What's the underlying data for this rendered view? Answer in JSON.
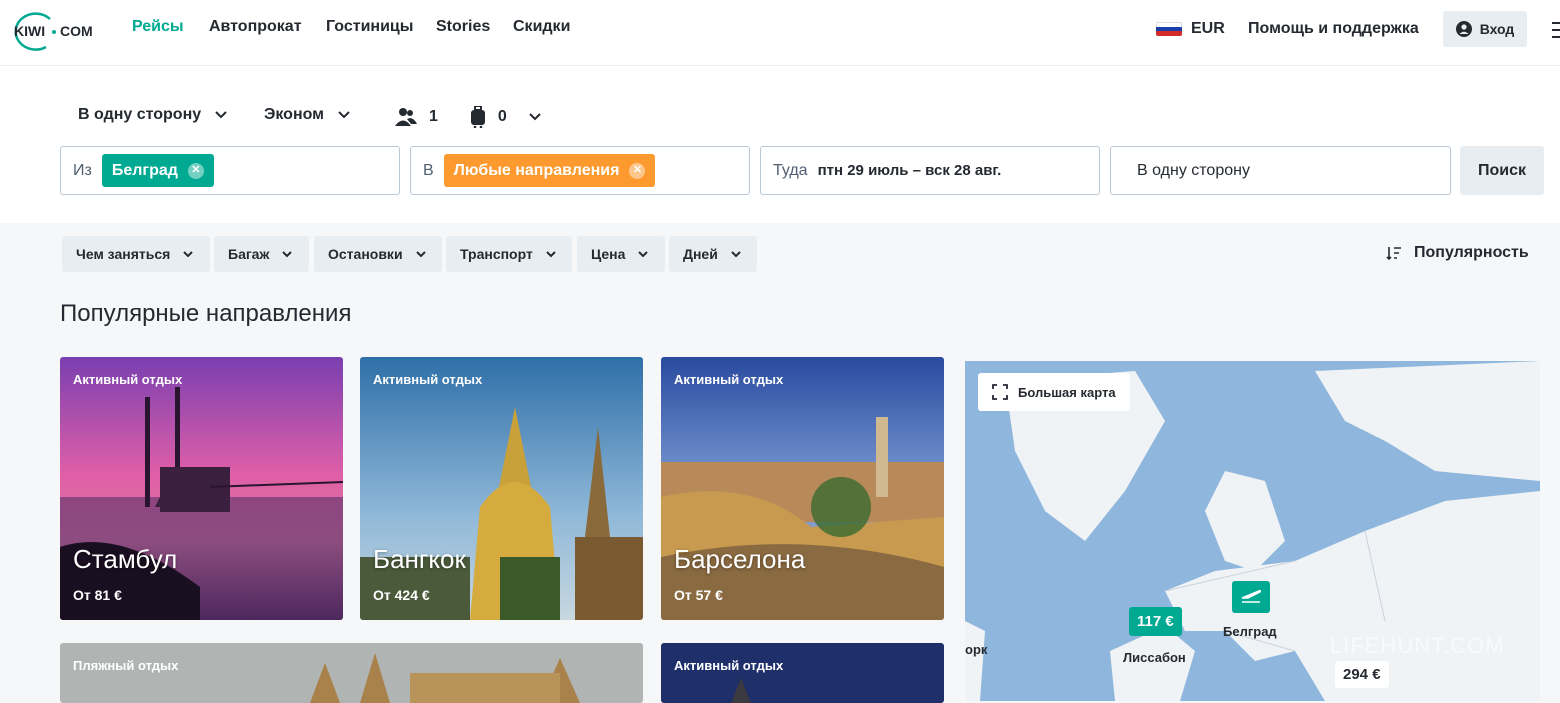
{
  "logo": {
    "text_left": "KIWI",
    "text_right": "COM"
  },
  "nav": [
    "Рейсы",
    "Автопрокат",
    "Гостиницы",
    "Stories",
    "Скидки"
  ],
  "header_right": {
    "currency": "EUR",
    "help": "Помощь и поддержка",
    "login": "Вход"
  },
  "search": {
    "trip_type": "В одну сторону",
    "cabin": "Эконом",
    "passengers": "1",
    "bags": "0",
    "from_label": "Из",
    "from_value": "Белград",
    "to_label": "В",
    "to_value": "Любые направления",
    "dates_label": "Туда",
    "dates_value": "птн 29 июль – вск 28 авг.",
    "return_value": "В одну сторону",
    "search_button": "Поиск"
  },
  "filters": [
    "Чем заняться",
    "Багаж",
    "Остановки",
    "Транспорт",
    "Цена",
    "Дней"
  ],
  "sort_label": "Популярность",
  "section_title": "Популярные направления",
  "cards": [
    {
      "category": "Активный отдых",
      "city": "Стамбул",
      "price": "От 81 €"
    },
    {
      "category": "Активный отдых",
      "city": "Бангкок",
      "price": "От 424 €"
    },
    {
      "category": "Активный отдых",
      "city": "Барселона",
      "price": "От 57 €"
    },
    {
      "category": "Пляжный отдых",
      "city": "",
      "price": ""
    },
    {
      "category": "Активный отдых",
      "city": "",
      "price": ""
    }
  ],
  "map": {
    "big_map": "Большая карта",
    "pin_lisbon_price": "117 €",
    "label_lisbon": "Лиссабон",
    "label_belgrade": "Белград",
    "label_york": "орк",
    "pin_294": "294 €"
  },
  "watermark": "LIFEHUNT.COM",
  "colors": {
    "brand": "#00a991",
    "orange": "#fc9a2f",
    "text": "#252a31",
    "map_water": "#8fb6dd",
    "map_land": "#f0f3f5"
  }
}
